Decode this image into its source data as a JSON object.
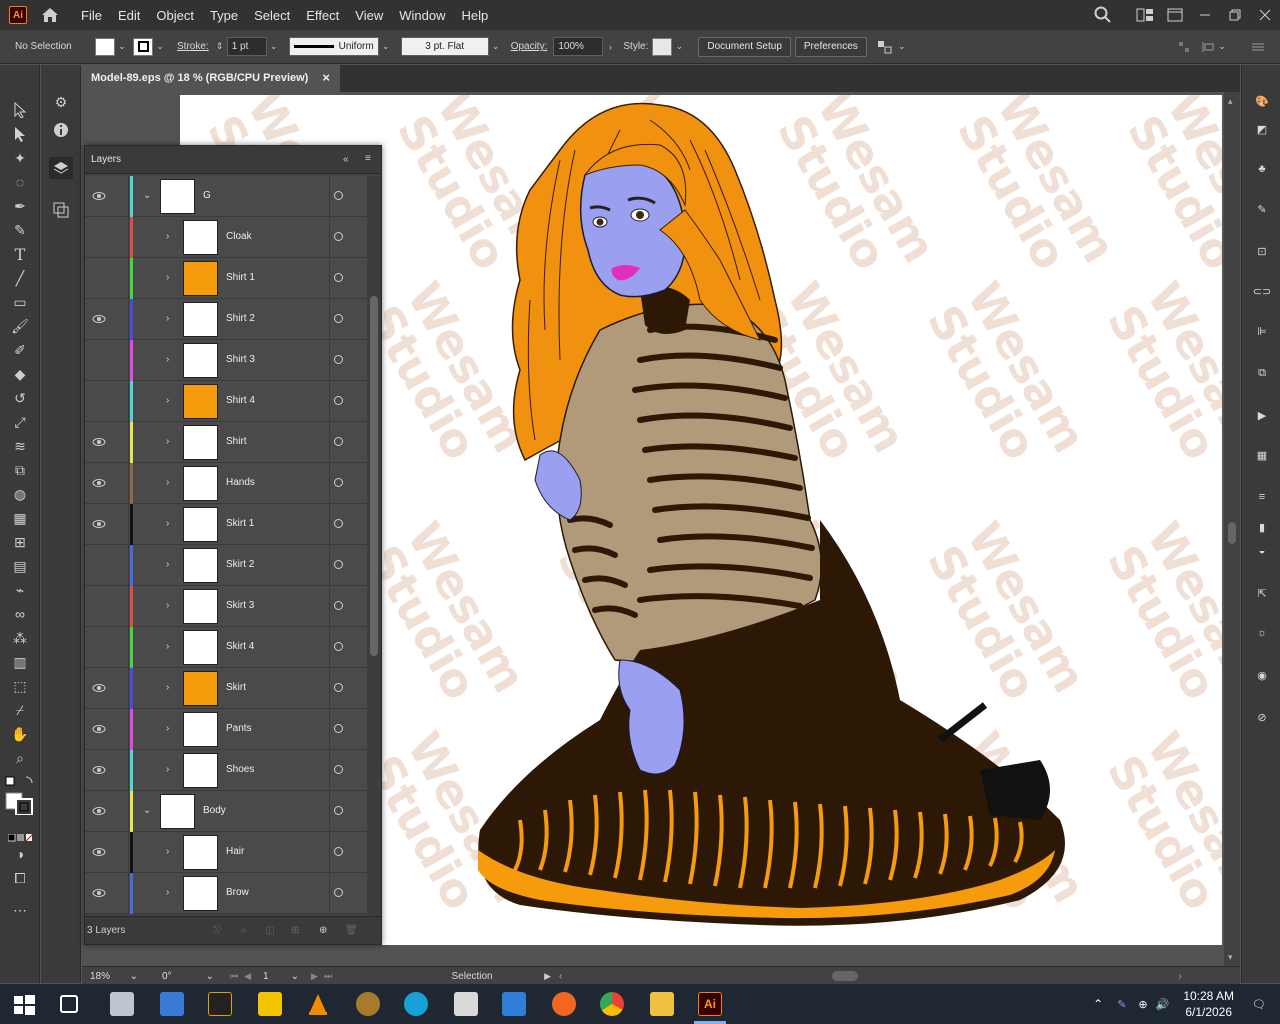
{
  "app": {
    "logo_text": "Ai"
  },
  "menu": [
    "File",
    "Edit",
    "Object",
    "Type",
    "Select",
    "Effect",
    "View",
    "Window",
    "Help"
  ],
  "control_bar": {
    "selection_label": "No Selection",
    "stroke_label": "Stroke:",
    "stroke_value": "1 pt",
    "stroke_profile": "Uniform",
    "brush": "3 pt. Flat",
    "opacity_label": "Opacity:",
    "opacity_value": "100%",
    "style_label": "Style:",
    "document_setup": "Document Setup",
    "preferences": "Preferences"
  },
  "document": {
    "tab_title": "Model-89.eps @ 18 % (RGB/CPU Preview)",
    "close": "×"
  },
  "layers_panel": {
    "title": "Layers",
    "footer": "3 Layers",
    "rows": [
      {
        "name": "G",
        "color": "#4fd6d6",
        "visible": true,
        "expanded": true,
        "indent": 0
      },
      {
        "name": "Cloak",
        "color": "#e04a4a",
        "visible": false,
        "expanded": false,
        "indent": 1
      },
      {
        "name": "Shirt 1",
        "color": "#44d444",
        "visible": false,
        "expanded": false,
        "indent": 1
      },
      {
        "name": "Shirt 2",
        "color": "#4a4ae0",
        "visible": true,
        "expanded": false,
        "indent": 1
      },
      {
        "name": "Shirt 3",
        "color": "#e04ae0",
        "visible": false,
        "expanded": false,
        "indent": 1
      },
      {
        "name": "Shirt 4",
        "color": "#4fd6d6",
        "visible": false,
        "expanded": false,
        "indent": 1
      },
      {
        "name": "Shirt",
        "color": "#e6e64a",
        "visible": true,
        "expanded": false,
        "indent": 1
      },
      {
        "name": "Hands",
        "color": "#8a6a4a",
        "visible": true,
        "expanded": false,
        "indent": 1
      },
      {
        "name": "Skirt 1",
        "color": "#111111",
        "visible": true,
        "expanded": false,
        "indent": 1
      },
      {
        "name": "Skirt 2",
        "color": "#4a6ae0",
        "visible": false,
        "expanded": false,
        "indent": 1
      },
      {
        "name": "Skirt 3",
        "color": "#e04a4a",
        "visible": false,
        "expanded": false,
        "indent": 1
      },
      {
        "name": "Skirt 4",
        "color": "#44d444",
        "visible": false,
        "expanded": false,
        "indent": 1
      },
      {
        "name": "Skirt",
        "color": "#4a4ae0",
        "visible": true,
        "expanded": false,
        "indent": 1
      },
      {
        "name": "Pants",
        "color": "#e04ae0",
        "visible": true,
        "expanded": false,
        "indent": 1
      },
      {
        "name": "Shoes",
        "color": "#4fd6d6",
        "visible": true,
        "expanded": false,
        "indent": 1
      },
      {
        "name": "Body",
        "color": "#e6e64a",
        "visible": true,
        "expanded": true,
        "indent": 0
      },
      {
        "name": "Hair",
        "color": "#111111",
        "visible": true,
        "expanded": false,
        "indent": 1
      },
      {
        "name": "Brow",
        "color": "#4a6ae0",
        "visible": true,
        "expanded": false,
        "indent": 1
      }
    ]
  },
  "status_bar": {
    "zoom": "18%",
    "rotation": "0°",
    "artboard": "1",
    "tool": "Selection"
  },
  "taskbar": {
    "time": "10:28 AM",
    "date": "6/1/2026"
  },
  "watermark": "Wesam\nStudio",
  "colors": {
    "hair": "#f0920f",
    "skin": "#9b9ff0",
    "shirt": "#b19a7a",
    "skirt": "#2c1804",
    "lips": "#e22ebc",
    "skirt_trim": "#f59b0c"
  }
}
